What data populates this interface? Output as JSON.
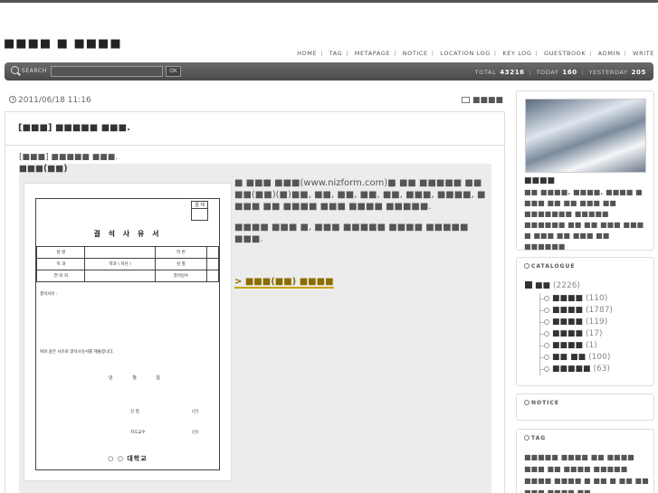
{
  "site": {
    "title": "■■■■ ■ ■■■■"
  },
  "topnav": {
    "items": [
      "HOME",
      "TAG",
      "METAPAGE",
      "NOTICE",
      "LOCATION LOG",
      "KEY LOG",
      "GUESTBOOK",
      "ADMIN",
      "WRITE"
    ]
  },
  "search": {
    "label": "SEARCH",
    "value": "",
    "button": "OK"
  },
  "stats": {
    "total_label": "TOTAL",
    "total": "43216",
    "today_label": "TODAY",
    "today": "160",
    "yesterday_label": "YESTERDAY",
    "yesterday": "205"
  },
  "post": {
    "date": "2011/06/18 11:16",
    "category": "■■■■",
    "title": "[■■■] ■■■■■ ■■■.",
    "subtitle": "[■■■] ■■■■■ ■■■.",
    "subtitle2": "■■■(■■)",
    "paragraph1": "■ ■■■ ■■■(www.nizform.com)■ ■■ ■■■■■ ■■ ■■(■■)(■)■■, ■■, ■■, ■■, ■■, ■■■, ■■■■, ■ ■■■ ■■ ■■■■ ■■■ ■■■■ ■■■■■.",
    "paragraph2": "■■■■ ■■■ ■, ■■■ ■■■■■ ■■■■ ■■■■■ ■■■.",
    "download_link": "> ■■■(■■) ■■■■"
  },
  "document": {
    "stamp": "결 재",
    "title": "결 석 사 유 서",
    "rows": [
      [
        "성 명",
        "",
        "학 번",
        ""
      ],
      [
        "학 과",
        "학과 ( 학년 )",
        "성 별",
        ""
      ],
      [
        "연 락 처",
        "",
        "결석일수",
        ""
      ]
    ],
    "note": "결석사유 :",
    "statement": "위와 같은 사유로 결석사유서를 제출합니다.",
    "date_line": "년 월 일",
    "sig1": "신 청",
    "sig2": "지도교수",
    "mark1": "(인)",
    "mark2": "(인)",
    "school": "○ ○ 대학교"
  },
  "sidebar": {
    "profile_name": "■■■■",
    "profile_desc": "■■ ■■■■. ■■■■. ■■■■ ■ ■■■ ■■ ■■ ■■■ ■■ ■■■■■■■ ■■■■■ ■■■■■■ ■■ ■■ ■■■ ■■■ ■ ■■■ ■■ ■■■ ■■ ■■■■■■",
    "catalogue_title": "CATALOGUE",
    "catalogue_root": "■■",
    "catalogue_root_count": "(2226)",
    "categories": [
      {
        "name": "■■■■",
        "count": "(110)"
      },
      {
        "name": "■■■■",
        "count": "(1787)"
      },
      {
        "name": "■■■■",
        "count": "(119)"
      },
      {
        "name": "■■■■",
        "count": "(17)"
      },
      {
        "name": "■■■■",
        "count": "(1)"
      },
      {
        "name": "■■ ■■",
        "count": "(100)"
      },
      {
        "name": "■■■■■",
        "count": "(63)"
      }
    ],
    "notice_title": "NOTICE",
    "tag_title": "TAG",
    "tags": "■■■■■ ■■■■ ■■ ■■■■ ■■■ ■■ ■■■■ ■■■■■ ■■■■ ■■■■ ■ ■■ ■ ■■ ■■ ■■■ ■■■■ ■■"
  }
}
